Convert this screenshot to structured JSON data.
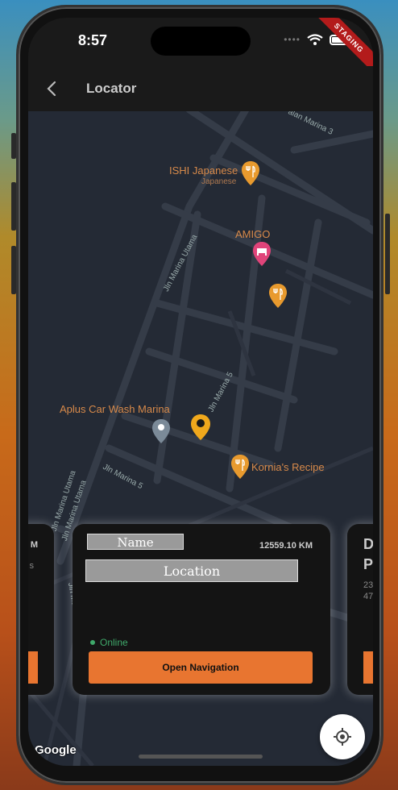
{
  "status_bar": {
    "time": "8:57",
    "signal_icon": "signal-dots-icon",
    "wifi_icon": "wifi-icon",
    "battery_icon": "battery-icon"
  },
  "debug_banner": {
    "label": "STAGING",
    "color": "#b31b1b"
  },
  "app_bar": {
    "title": "Locator",
    "back_icon": "chevron-left-icon"
  },
  "map": {
    "pois": [
      {
        "label": "ISHI Japanese",
        "sublabel": "Japanese",
        "icon": "restaurant-pin-icon"
      },
      {
        "label": "AMIGO",
        "icon": "hotel-pin-icon"
      },
      {
        "label": "",
        "icon": "restaurant-pin-icon"
      },
      {
        "label": "Aplus Car Wash Marina",
        "icon": "place-pin-icon"
      },
      {
        "label": "Kornia's Recipe",
        "icon": "restaurant-pin-icon"
      }
    ],
    "streets": [
      "alan Marina 3",
      "Jln Marina Utama",
      "Jln Marina 5",
      "Jln Marina 5",
      "Jln Marina Utama",
      "Jln Marina Utama",
      "Jln Marina Utama"
    ],
    "attribution": "Google"
  },
  "cards": {
    "main": {
      "name": "Name",
      "location": "Location",
      "distance": "12559.10 KM",
      "status": "Online",
      "status_color": "#3fa86a",
      "button_label": "Open Navigation",
      "button_color": "#e87530"
    },
    "left_partial": {
      "text1": "M",
      "text2": "s"
    },
    "right_partial": {
      "text1": "D",
      "text2": "P",
      "text3": "23",
      "text4": "47"
    }
  },
  "locate_button": {
    "icon": "my-location-icon"
  }
}
